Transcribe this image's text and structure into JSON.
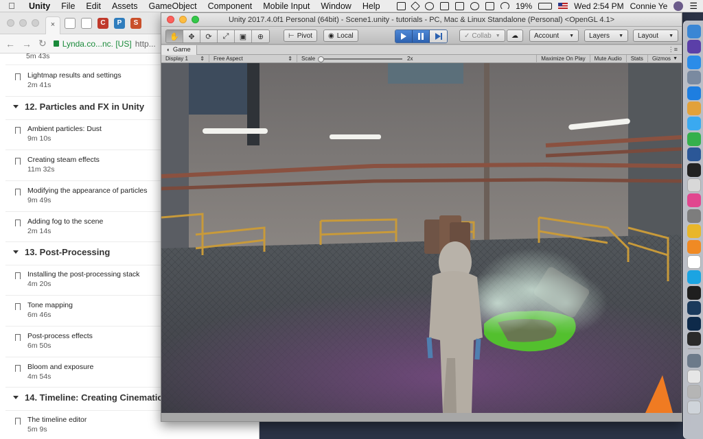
{
  "menubar": {
    "apple_glyph": "",
    "items": [
      "Unity",
      "File",
      "Edit",
      "Assets",
      "GameObject",
      "Component",
      "Mobile Input",
      "Window",
      "Help"
    ],
    "battery": "19%",
    "clock": "Wed 2:54 PM",
    "user": "Connie Ye"
  },
  "browser": {
    "tab_close": "×",
    "address_site": "Lynda.co...nc. [US]",
    "address_rest": "http...",
    "favicons": [
      {
        "label": "",
        "color": "#ffffff",
        "icon": "document-icon"
      },
      {
        "label": "",
        "color": "#ffffff",
        "icon": "document-icon"
      },
      {
        "label": "C",
        "color": "#c0392b",
        "icon": "c-app-icon"
      },
      {
        "label": "P",
        "color": "#2f7dbd",
        "icon": "p-app-icon"
      },
      {
        "label": "S",
        "color": "#c94f2a",
        "icon": "s-app-icon"
      }
    ],
    "course": {
      "top_duration": "5m 43s",
      "sections": [
        {
          "type": "entry",
          "title": "Lightmap results and settings",
          "duration": "2m 41s"
        },
        {
          "type": "chapter",
          "title": "12. Particles and FX in Unity"
        },
        {
          "type": "entry",
          "title": "Ambient particles: Dust",
          "duration": "9m 10s"
        },
        {
          "type": "entry",
          "title": "Creating steam effects",
          "duration": "11m 32s"
        },
        {
          "type": "entry",
          "title": "Modifying the appearance of particles",
          "duration": "9m 49s"
        },
        {
          "type": "entry",
          "title": "Adding fog to the scene",
          "duration": "2m 14s"
        },
        {
          "type": "chapter",
          "title": "13. Post-Processing"
        },
        {
          "type": "entry",
          "title": "Installing the post-processing stack",
          "duration": "4m 20s"
        },
        {
          "type": "entry",
          "title": "Tone mapping",
          "duration": "6m 46s"
        },
        {
          "type": "entry",
          "title": "Post-process effects",
          "duration": "6m 50s"
        },
        {
          "type": "entry",
          "title": "Bloom and exposure",
          "duration": "4m 54s"
        },
        {
          "type": "chapter",
          "title": "14. Timeline: Creating Cinematic"
        },
        {
          "type": "entry",
          "title": "The timeline editor",
          "duration": "5m 9s"
        }
      ]
    }
  },
  "unity": {
    "title": "Unity 2017.4.0f1 Personal (64bit) - Scene1.unity - tutorials - PC, Mac & Linux Standalone (Personal) <OpenGL 4.1>",
    "tools": [
      "✋",
      "✥",
      "⟳",
      "⤢",
      "▣",
      "⊕"
    ],
    "pivot": "Pivot",
    "local": "Local",
    "collab": "Collab",
    "account": "Account",
    "layers": "Layers",
    "layout": "Layout",
    "game_tab": "Game",
    "display": "Display 1",
    "aspect": "Free Aspect",
    "scale_label": "Scale",
    "scale_value": "2x",
    "maximize": "Maximize On Play",
    "mute": "Mute Audio",
    "stats": "Stats",
    "gizmos": "Gizmos",
    "play_state": "playing"
  },
  "dock": [
    {
      "name": "finder-icon",
      "color": "#3a86d4"
    },
    {
      "name": "siri-icon",
      "color": "#5b3fa8"
    },
    {
      "name": "app-store-icon",
      "color": "#2b8ce8"
    },
    {
      "name": "launchpad-icon",
      "color": "#7a8aa0"
    },
    {
      "name": "safari-icon",
      "color": "#1e7ee0"
    },
    {
      "name": "photos-icon",
      "color": "#e2a13a"
    },
    {
      "name": "messages-icon",
      "color": "#3aa9f0"
    },
    {
      "name": "facetime-icon",
      "color": "#35b04b"
    },
    {
      "name": "word-icon",
      "color": "#2b5797"
    },
    {
      "name": "terminal-icon",
      "color": "#222222"
    },
    {
      "name": "textedit-icon",
      "color": "#d8d8d8"
    },
    {
      "name": "itunes-icon",
      "color": "#e1478f"
    },
    {
      "name": "system-preferences-icon",
      "color": "#7d7d7d"
    },
    {
      "name": "chrome-icon",
      "color": "#e8b62a"
    },
    {
      "name": "sublime-icon",
      "color": "#f08a24"
    },
    {
      "name": "calendar-icon",
      "color": "#ffffff"
    },
    {
      "name": "skype-icon",
      "color": "#1ba4e2"
    },
    {
      "name": "spotify-icon",
      "color": "#1f1f1f"
    },
    {
      "name": "steam-icon",
      "color": "#1b3a5c"
    },
    {
      "name": "photoshop-icon",
      "color": "#0e2a4a"
    },
    {
      "name": "unity-icon",
      "color": "#2a2a2a"
    },
    {
      "name": "migration-icon",
      "color": "#6c7a8a"
    },
    {
      "name": "documents-stack-icon",
      "color": "#e6e6e6"
    },
    {
      "name": "help-icon",
      "color": "#b5b5b5"
    },
    {
      "name": "trash-icon",
      "color": "#cfd4da"
    }
  ]
}
